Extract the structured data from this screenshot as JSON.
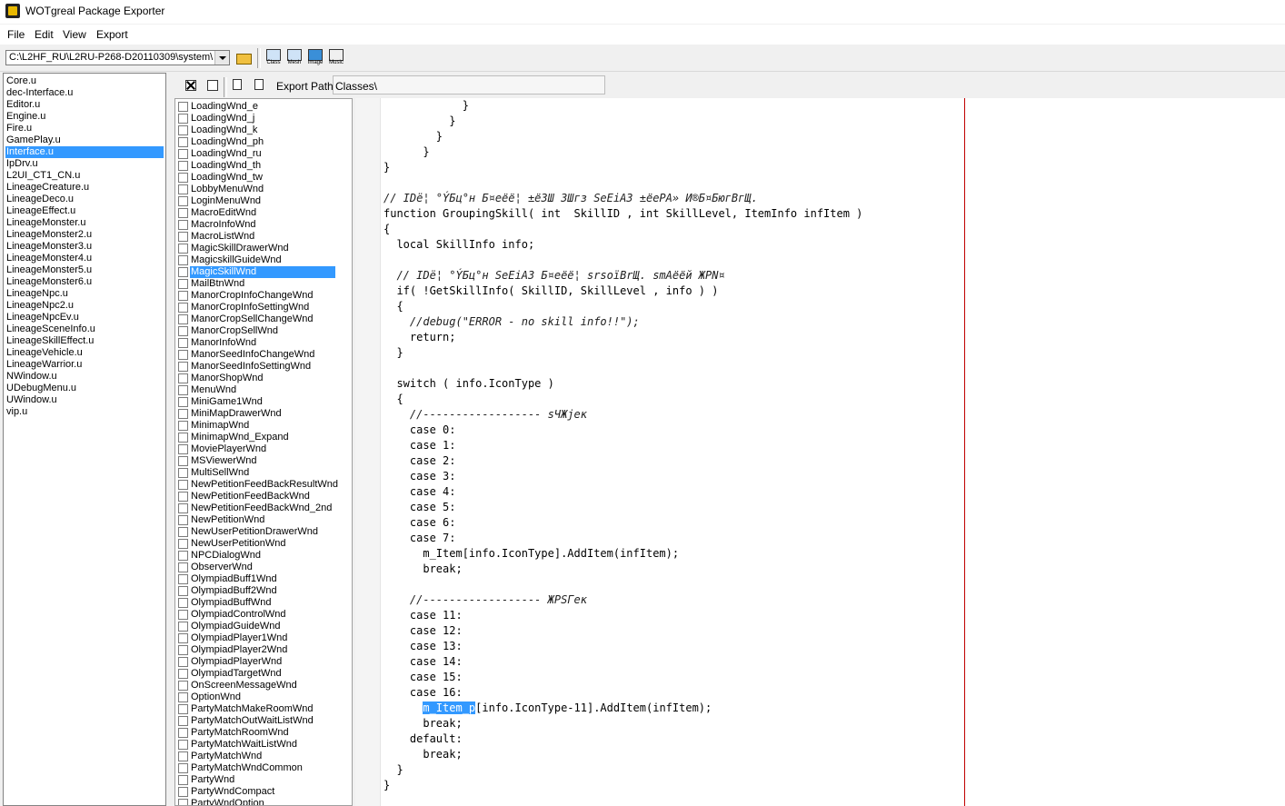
{
  "window": {
    "title": "WOTgreal Package Exporter"
  },
  "menu": [
    "File",
    "Edit",
    "View",
    "Export"
  ],
  "toolbar": {
    "path": "C:\\L2HF_RU\\L2RU-P268-D20110309\\system\\",
    "buttons": [
      "Class",
      "Mesh",
      "Image",
      "Music"
    ]
  },
  "packages": {
    "items": [
      "Core.u",
      "dec-Interface.u",
      "Editor.u",
      "Engine.u",
      "Fire.u",
      "GamePlay.u",
      "Interface.u",
      "IpDrv.u",
      "L2UI_CT1_CN.u",
      "LineageCreature.u",
      "LineageDeco.u",
      "LineageEffect.u",
      "LineageMonster.u",
      "LineageMonster2.u",
      "LineageMonster3.u",
      "LineageMonster4.u",
      "LineageMonster5.u",
      "LineageMonster6.u",
      "LineageNpc.u",
      "LineageNpc2.u",
      "LineageNpcEv.u",
      "LineageSceneInfo.u",
      "LineageSkillEffect.u",
      "LineageVehicle.u",
      "LineageWarrior.u",
      "NWindow.u",
      "UDebugMenu.u",
      "UWindow.u",
      "vip.u"
    ],
    "selected_index": 6
  },
  "export": {
    "label": "Export Path:",
    "path": "Classes\\"
  },
  "classes": {
    "items": [
      "LoadingWnd_e",
      "LoadingWnd_j",
      "LoadingWnd_k",
      "LoadingWnd_ph",
      "LoadingWnd_ru",
      "LoadingWnd_th",
      "LoadingWnd_tw",
      "LobbyMenuWnd",
      "LoginMenuWnd",
      "MacroEditWnd",
      "MacroInfoWnd",
      "MacroListWnd",
      "MagicSkillDrawerWnd",
      "MagicskillGuideWnd",
      "MagicSkillWnd",
      "MailBtnWnd",
      "ManorCropInfoChangeWnd",
      "ManorCropInfoSettingWnd",
      "ManorCropSellChangeWnd",
      "ManorCropSellWnd",
      "ManorInfoWnd",
      "ManorSeedInfoChangeWnd",
      "ManorSeedInfoSettingWnd",
      "ManorShopWnd",
      "MenuWnd",
      "MiniGame1Wnd",
      "MiniMapDrawerWnd",
      "MinimapWnd",
      "MinimapWnd_Expand",
      "MoviePlayerWnd",
      "MSViewerWnd",
      "MultiSellWnd",
      "NewPetitionFeedBackResultWnd",
      "NewPetitionFeedBackWnd",
      "NewPetitionFeedBackWnd_2nd",
      "NewPetitionWnd",
      "NewUserPetitionDrawerWnd",
      "NewUserPetitionWnd",
      "NPCDialogWnd",
      "ObserverWnd",
      "OlympiadBuff1Wnd",
      "OlympiadBuff2Wnd",
      "OlympiadBuffWnd",
      "OlympiadControlWnd",
      "OlympiadGuideWnd",
      "OlympiadPlayer1Wnd",
      "OlympiadPlayer2Wnd",
      "OlympiadPlayerWnd",
      "OlympiadTargetWnd",
      "OnScreenMessageWnd",
      "OptionWnd",
      "PartyMatchMakeRoomWnd",
      "PartyMatchOutWaitListWnd",
      "PartyMatchRoomWnd",
      "PartyMatchWaitListWnd",
      "PartyMatchWnd",
      "PartyMatchWndCommon",
      "PartyWnd",
      "PartyWndCompact",
      "PartyWndOption"
    ],
    "selected_index": 14
  },
  "code": {
    "lines": [
      {
        "t": "            }",
        "c": false
      },
      {
        "t": "          }",
        "c": false
      },
      {
        "t": "        }",
        "c": false
      },
      {
        "t": "      }",
        "c": false
      },
      {
        "t": "}",
        "c": false
      },
      {
        "t": "",
        "c": false
      },
      {
        "t": "// IDë¦ °ÝБц°н Б¤еёё¦ ±ёЗШ ЗШгз SeEiA3 ±ёеРА» И®Б¤БюгВгЩ.",
        "c": true
      },
      {
        "t": "function GroupingSkill( int  SkillID , int SkillLevel, ItemInfo infItem )",
        "c": false
      },
      {
        "t": "{",
        "c": false
      },
      {
        "t": "  local SkillInfo info;",
        "c": false
      },
      {
        "t": "",
        "c": false
      },
      {
        "t": "  // IDë¦ °ÝБц°н SeEiA3 Б¤еёё¦ srsoïBrЩ. smAёёй ЖРN¤",
        "c": true
      },
      {
        "t": "  if( !GetSkillInfo( SkillID, SkillLevel , info ) )",
        "c": false
      },
      {
        "t": "  {",
        "c": false
      },
      {
        "t": "    //debug(\"ERROR - no skill info!!\");",
        "c": true
      },
      {
        "t": "    return;",
        "c": false
      },
      {
        "t": "  }",
        "c": false
      },
      {
        "t": "",
        "c": false
      },
      {
        "t": "  switch ( info.IconType )",
        "c": false
      },
      {
        "t": "  {",
        "c": false
      },
      {
        "t": "    //------------------ sЧЖjeк",
        "c": true
      },
      {
        "t": "    case 0:",
        "c": false
      },
      {
        "t": "    case 1:",
        "c": false
      },
      {
        "t": "    case 2:",
        "c": false
      },
      {
        "t": "    case 3:",
        "c": false
      },
      {
        "t": "    case 4:",
        "c": false
      },
      {
        "t": "    case 5:",
        "c": false
      },
      {
        "t": "    case 6:",
        "c": false
      },
      {
        "t": "    case 7:",
        "c": false
      },
      {
        "t": "      m_Item[info.IconType].AddItem(infItem);",
        "c": false
      },
      {
        "t": "      break;",
        "c": false
      },
      {
        "t": "",
        "c": false
      },
      {
        "t": "    //------------------ ЖРSГeк",
        "c": true
      },
      {
        "t": "    case 11:",
        "c": false
      },
      {
        "t": "    case 12:",
        "c": false
      },
      {
        "t": "    case 13:",
        "c": false
      },
      {
        "t": "    case 14:",
        "c": false
      },
      {
        "t": "    case 15:",
        "c": false
      },
      {
        "t": "    case 16:",
        "c": false
      },
      {
        "t": "      m_Item_p[info.IconType-11].AddItem(infItem);",
        "c": false,
        "hl": "m_Item_p"
      },
      {
        "t": "      break;",
        "c": false
      },
      {
        "t": "    default:",
        "c": false
      },
      {
        "t": "      break;",
        "c": false
      },
      {
        "t": "  }",
        "c": false
      },
      {
        "t": "}",
        "c": false
      }
    ]
  }
}
